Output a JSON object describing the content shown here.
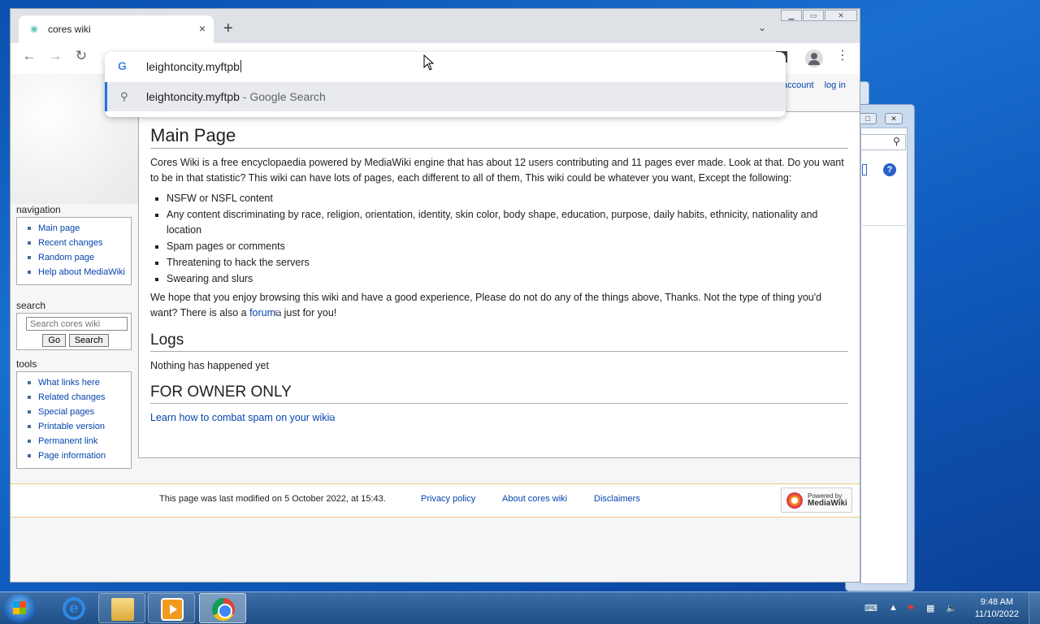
{
  "browser": {
    "tab_title": "cores wiki",
    "tab_close": "×",
    "new_tab": "+",
    "tab_search": "⌄",
    "omnibox_text": "leightoncity.myftpb",
    "suggestion_query": "leightoncity.myftpb",
    "suggestion_suffix": "- Google Search",
    "google_g": "G",
    "back": "←",
    "forward": "→",
    "reload": "↻",
    "menu": "⋮"
  },
  "personal": {
    "account": "account",
    "login": "log in"
  },
  "navigation": {
    "heading": "navigation",
    "items": [
      "Main page",
      "Recent changes",
      "Random page",
      "Help about MediaWiki"
    ]
  },
  "search": {
    "heading": "search",
    "placeholder": "Search cores wiki",
    "go": "Go",
    "search": "Search"
  },
  "tools": {
    "heading": "tools",
    "items": [
      "What links here",
      "Related changes",
      "Special pages",
      "Printable version",
      "Permanent link",
      "Page information"
    ]
  },
  "content": {
    "title": "Main Page",
    "intro": "Cores Wiki is a free encyclopaedia powered by MediaWiki engine that has about 12 users contributing and 11 pages ever made. Look at that. Do you want to be in that statistic? This wiki can have lots of pages, each different to all of them, This wiki could be whatever you want, Except the following:",
    "rules": [
      "NSFW or NSFL content",
      "Any content discriminating by race, religion, orientation, identity, skin color, body shape, education, purpose, daily habits, ethnicity, nationality and location",
      "Spam pages or comments",
      "Threatening to hack the servers",
      "Swearing and slurs"
    ],
    "closing_before": "We hope that you enjoy browsing this wiki and have a good experience, Please do not do any of the things above, Thanks. Not the type of thing you'd want? There is also a",
    "forum_link": "forum",
    "closing_after": "just for you!",
    "logs_heading": "Logs",
    "logs_text": "Nothing has happened yet",
    "owner_heading": "FOR OWNER ONLY",
    "spam_link": "Learn how to combat spam on your wiki"
  },
  "footer": {
    "modified": "This page was last modified on 5 October 2022, at 15:43.",
    "privacy": "Privacy policy",
    "about": "About cores wiki",
    "disclaimers": "Disclaimers",
    "powered_line1": "Powered by",
    "powered_line2": "MediaWiki"
  },
  "taskbar": {
    "time": "9:48 AM",
    "date": "11/10/2022",
    "ie_letter": "e"
  }
}
